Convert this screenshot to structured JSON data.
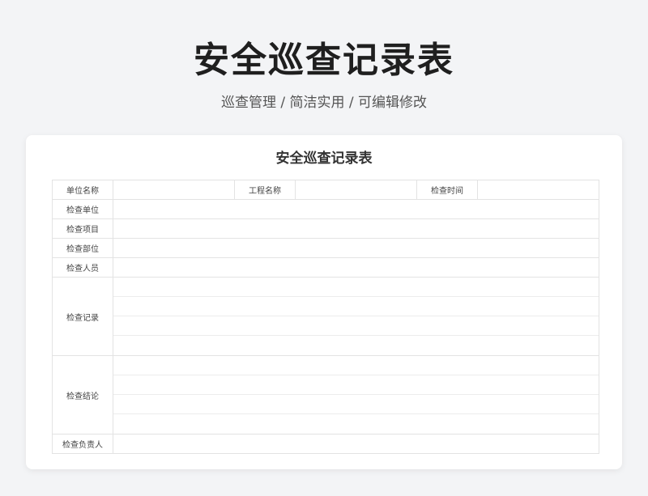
{
  "header": {
    "title": "安全巡查记录表",
    "subtitle": "巡查管理 / 简洁实用 /  可编辑修改"
  },
  "form": {
    "title": "安全巡查记录表",
    "top_row": {
      "unit_name_label": "单位名称",
      "project_name_label": "工程名称",
      "check_time_label": "检查时间"
    },
    "rows": {
      "check_unit": "检查单位",
      "check_item": "检查项目",
      "check_dept": "检查部位",
      "check_staff": "检查人员",
      "check_record": "检查记录",
      "check_conclusion": "检查结论",
      "check_owner": "检查负责人"
    }
  }
}
